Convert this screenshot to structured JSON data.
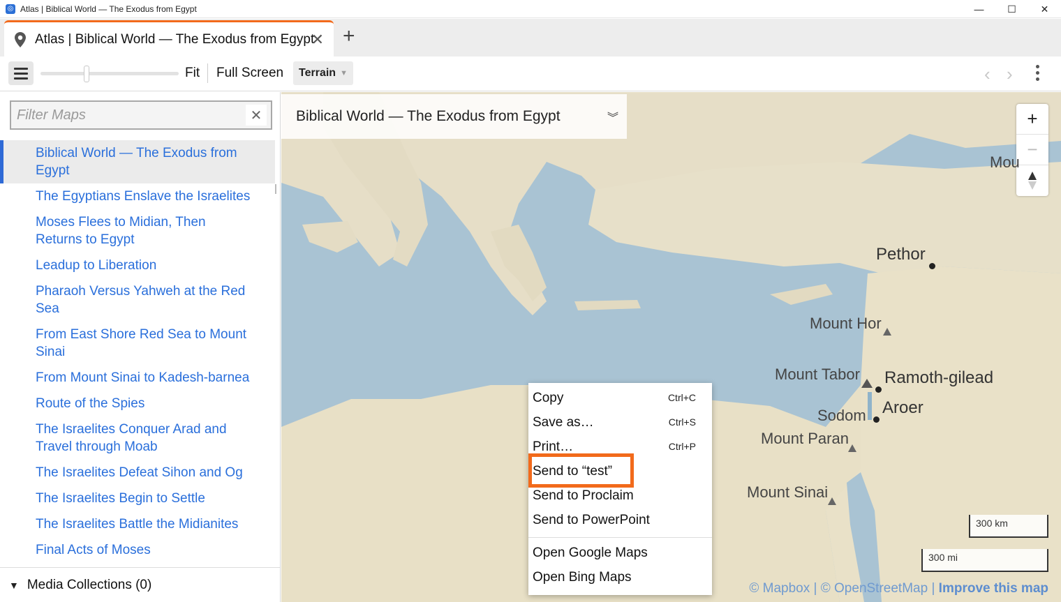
{
  "window": {
    "title": "Atlas | Biblical World — The Exodus from Egypt",
    "minimize": "—",
    "maximize": "☐",
    "close": "✕"
  },
  "tab": {
    "label": "Atlas | Biblical World — The Exodus from Egypt",
    "close": "✕",
    "add": "+"
  },
  "toolbar": {
    "fit_label": "Fit",
    "fullscreen_label": "Full Screen",
    "layer_select": "Terrain",
    "back": "‹",
    "forward": "›"
  },
  "sidebar": {
    "filter_placeholder": "Filter Maps",
    "filter_clear": "✕",
    "items": [
      {
        "label": "Biblical World — The Exodus from Egypt",
        "active": true
      },
      {
        "label": "The Egyptians Enslave the Israelites"
      },
      {
        "label": "Moses Flees to Midian, Then Returns to Egypt"
      },
      {
        "label": "Leadup to Liberation"
      },
      {
        "label": "Pharaoh Versus Yahweh at the Red Sea"
      },
      {
        "label": "From East Shore Red Sea to Mount Sinai"
      },
      {
        "label": "From Mount Sinai to Kadesh-barnea"
      },
      {
        "label": "Route of the Spies"
      },
      {
        "label": "The Israelites Conquer Arad and Travel through Moab"
      },
      {
        "label": "The Israelites Defeat Sihon and Og"
      },
      {
        "label": "The Israelites Begin to Settle"
      },
      {
        "label": "The Israelites Battle the Midianites"
      },
      {
        "label": "Final Acts of Moses"
      }
    ],
    "media_collections": "Media Collections (0)"
  },
  "map": {
    "title": "Biblical World — The Exodus from Egypt",
    "zoom_in": "+",
    "zoom_out": "−",
    "places": {
      "pethor": "Pethor",
      "mount_hor": "Mount Hor",
      "mount_tabor": "Mount Tabor",
      "ramoth_gilead": "Ramoth-gilead",
      "sodom": "Sodom",
      "aroer": "Aroer",
      "mount_paran": "Mount Paran",
      "mount_sinai": "Mount Sinai",
      "mou": "Mou"
    },
    "scale_km": "300 km",
    "scale_mi": "300 mi",
    "attribution_mapbox": "© Mapbox",
    "attribution_osm": "© OpenStreetMap",
    "attribution_improve": "Improve this map",
    "attribution_sep": "|"
  },
  "context_menu": {
    "items": [
      {
        "label": "Copy",
        "shortcut": "Ctrl+C"
      },
      {
        "label": "Save as…",
        "shortcut": "Ctrl+S"
      },
      {
        "label": "Print…",
        "shortcut": "Ctrl+P"
      },
      {
        "label": "Send to “test”",
        "shortcut": ""
      },
      {
        "label": "Send to Proclaim",
        "shortcut": ""
      },
      {
        "label": "Send to PowerPoint",
        "shortcut": ""
      },
      {
        "label": "Open Google Maps",
        "shortcut": ""
      },
      {
        "label": "Open Bing Maps",
        "shortcut": ""
      }
    ]
  },
  "colors": {
    "accent_orange": "#f26a1b",
    "link_blue": "#2a6fdb",
    "sea": "#a9c3d3",
    "land": "#e6dec7"
  }
}
